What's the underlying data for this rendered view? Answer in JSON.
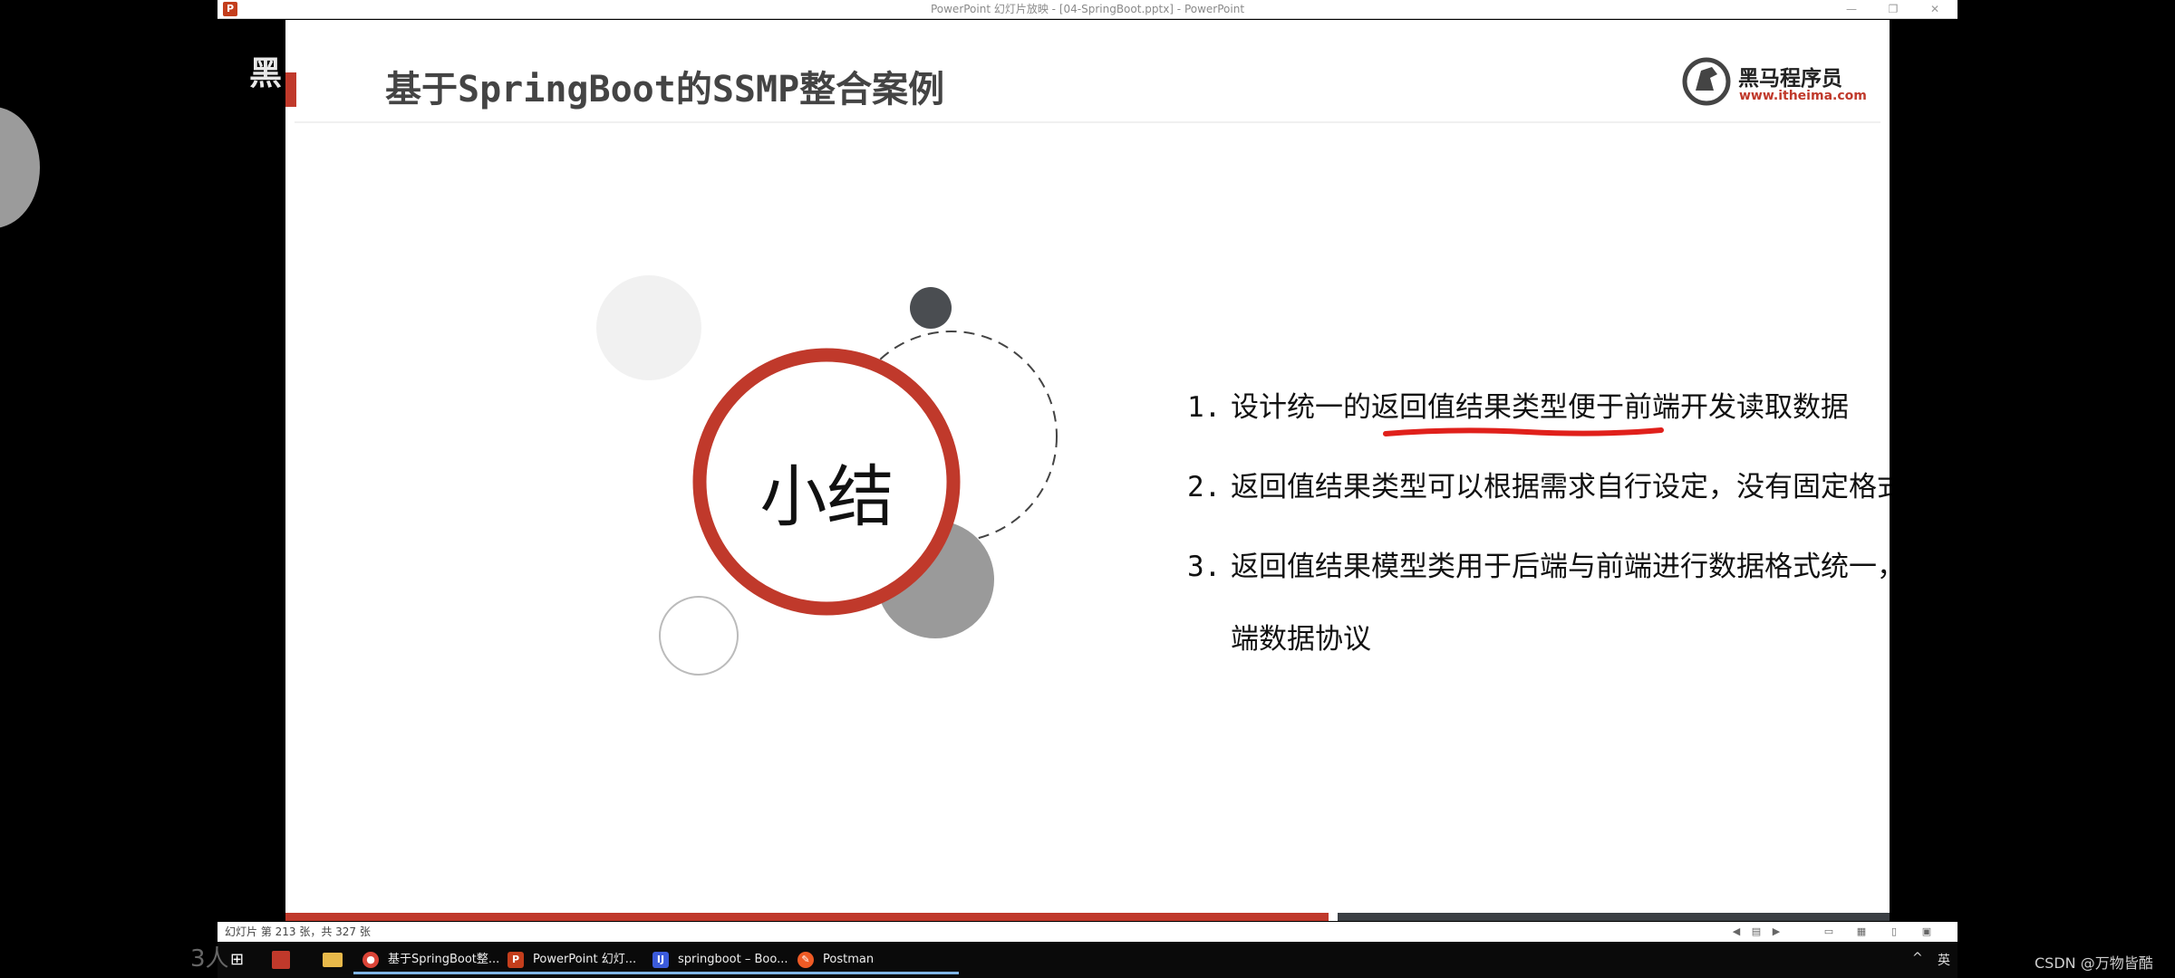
{
  "window": {
    "title": "PowerPoint 幻灯片放映 - [04-SpringBoot.pptx] - PowerPoint",
    "app_icon_label": "P",
    "controls": {
      "minimize": "—",
      "restore": "❐",
      "close": "✕"
    }
  },
  "slide": {
    "title": "基于SpringBoot的SSMP整合案例",
    "logo": {
      "name": "黑马程序员",
      "url": "www.itheima.com"
    },
    "summary_label": "小结",
    "points": [
      {
        "num": "1.",
        "before": "设计统一的",
        "highlight": "返回值结果类型",
        "after": "便于前端开发读取数据"
      },
      {
        "num": "2.",
        "text": "返回值结果类型可以根据需求自行设定，没有固定格式"
      },
      {
        "num": "3.",
        "line1": "返回值结果模型类用于后端与前端进行数据格式统一，也称为前后",
        "line2": "端数据协议"
      }
    ],
    "progress": {
      "fraction": 0.65
    },
    "colors": {
      "accent": "#c0392b",
      "ring": "#c0392b",
      "dark": "#4a4d51",
      "gray": "#9a9a9a"
    }
  },
  "statusbar": {
    "slide_counter": "幻灯片 第 213 张，共 327 张",
    "icons": [
      "prev-icon",
      "menu-icon",
      "next-icon",
      "normal-view-icon",
      "sorter-view-icon",
      "reading-view-icon",
      "slideshow-icon"
    ]
  },
  "taskbar": {
    "items": [
      {
        "label": "基于SpringBoot整...",
        "icon": "chrome-icon",
        "color": "#db4437"
      },
      {
        "label": "PowerPoint 幻灯...",
        "icon": "powerpoint-icon",
        "color": "#c43e1c"
      },
      {
        "label": "springboot – Boo...",
        "icon": "intellij-icon",
        "color": "#3b5bdb"
      },
      {
        "label": "Postman",
        "icon": "postman-icon",
        "color": "#ef5b25"
      }
    ],
    "tray": {
      "chevron": "^",
      "ime": "英"
    }
  },
  "overlay": {
    "left_text": "黑",
    "viewer_count": "3人",
    "watermark": "CSDN @万物皆酷"
  }
}
